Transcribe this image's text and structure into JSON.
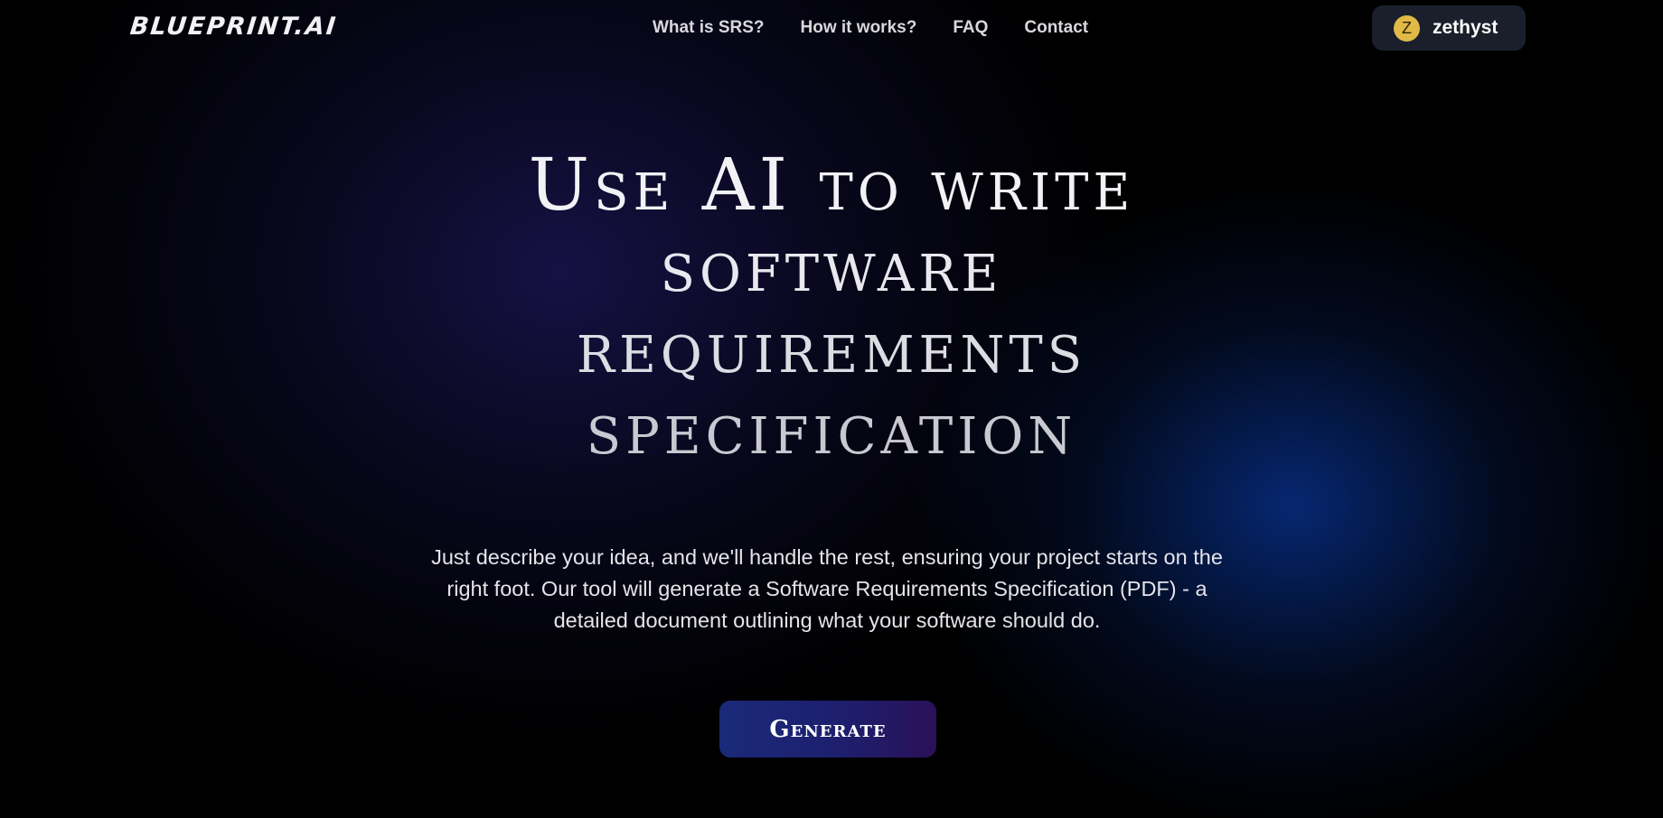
{
  "brand": {
    "logo_text": "BLUEPRINT.AI"
  },
  "nav": {
    "items": [
      {
        "label": "What is SRS?"
      },
      {
        "label": "How it works?"
      },
      {
        "label": "FAQ"
      },
      {
        "label": "Contact"
      }
    ]
  },
  "user": {
    "initial": "Z",
    "name": "zethyst",
    "avatar_color": "#e0b946"
  },
  "hero": {
    "title_lines": [
      "Use AI to write",
      "software",
      "requirements",
      "specification"
    ],
    "description": "Just describe your idea, and we'll handle the rest, ensuring your project starts on the right foot. Our tool will generate a Software Requirements Specification (PDF) - a detailed document outlining what your software should do.",
    "cta_label": "Generate"
  },
  "colors": {
    "background": "#000000",
    "accent_blue": "#0834a0",
    "button_gradient_start": "#1a2a78",
    "button_gradient_end": "#2a1158",
    "user_chip_bg": "#1a1f2b"
  }
}
